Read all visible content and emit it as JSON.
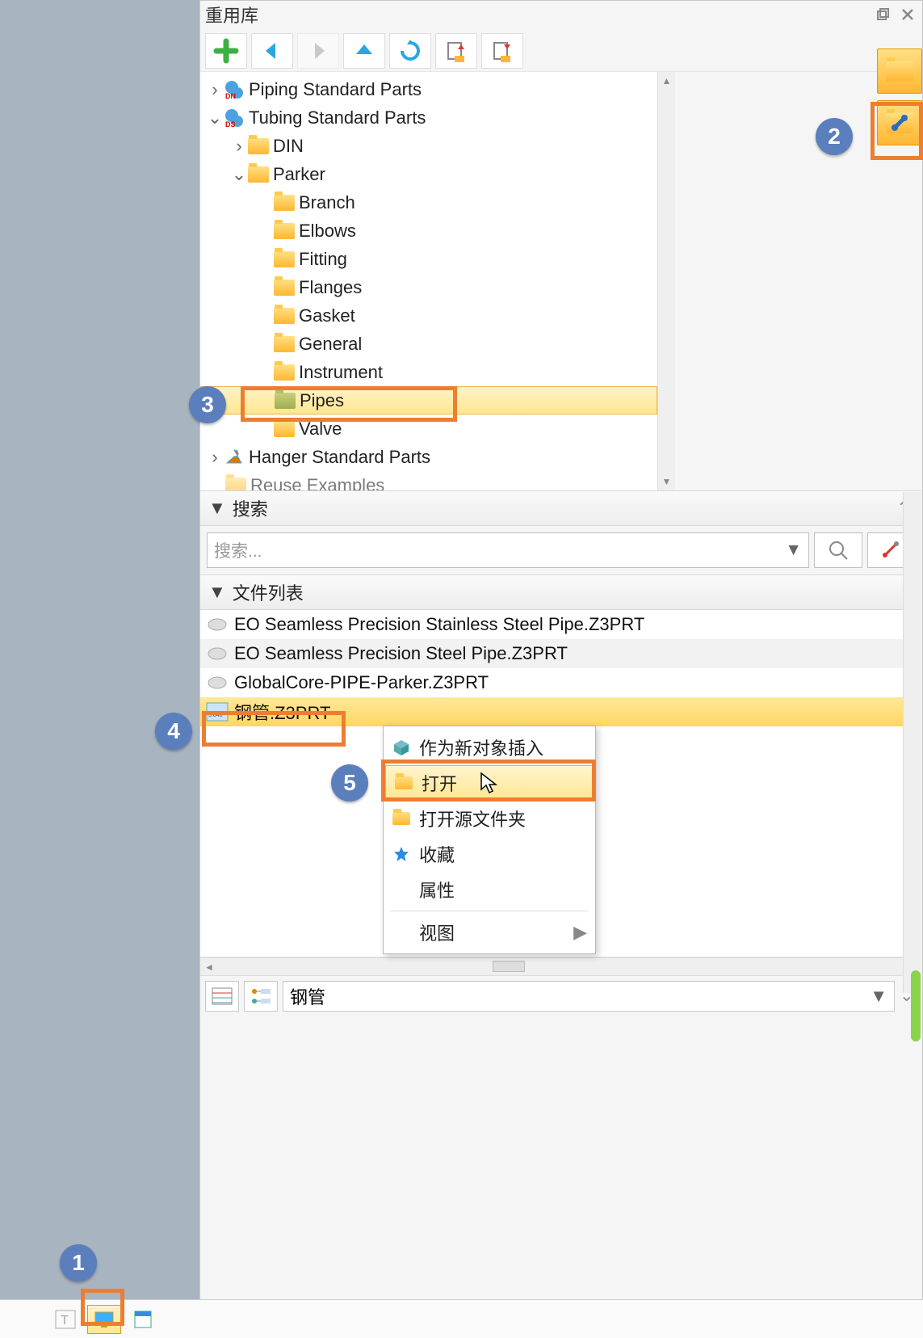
{
  "panel": {
    "title": "重用库"
  },
  "toolbar": {
    "icons": [
      "add",
      "back",
      "forward",
      "up",
      "refresh",
      "doc-up",
      "doc-down"
    ]
  },
  "tree": {
    "items": [
      {
        "label": "Piping Standard Parts",
        "icon": "pipe-dn",
        "arrow": ">"
      },
      {
        "label": "Tubing Standard Parts",
        "icon": "pipe-ds",
        "arrow": "v",
        "children": [
          {
            "label": "DIN",
            "icon": "folder",
            "arrow": ">"
          },
          {
            "label": "Parker",
            "icon": "folder-open",
            "arrow": "v",
            "children": [
              {
                "label": "Branch",
                "icon": "folder"
              },
              {
                "label": "Elbows",
                "icon": "folder"
              },
              {
                "label": "Fitting",
                "icon": "folder"
              },
              {
                "label": "Flanges",
                "icon": "folder"
              },
              {
                "label": "Gasket",
                "icon": "folder"
              },
              {
                "label": "General",
                "icon": "folder"
              },
              {
                "label": "Instrument",
                "icon": "folder"
              },
              {
                "label": "Pipes",
                "icon": "folder-sel",
                "selected": true
              },
              {
                "label": "Valve",
                "icon": "folder"
              }
            ]
          }
        ]
      },
      {
        "label": "Hanger Standard Parts",
        "icon": "hanger",
        "arrow": ">"
      },
      {
        "label": "Reuse Examples",
        "icon": "folder-star"
      }
    ]
  },
  "search": {
    "header": "搜索",
    "placeholder": "搜索..."
  },
  "filelist": {
    "header": "文件列表",
    "files": [
      "EO Seamless Precision Stainless Steel Pipe.Z3PRT",
      "EO Seamless Precision Steel Pipe.Z3PRT",
      "GlobalCore-PIPE-Parker.Z3PRT",
      "钢管.Z3PRT"
    ]
  },
  "context_menu": {
    "items": [
      {
        "label": "作为新对象插入",
        "icon": "cube"
      },
      {
        "label": "打开",
        "icon": "folder",
        "highlight": true
      },
      {
        "label": "打开源文件夹",
        "icon": "folder"
      },
      {
        "label": "收藏",
        "icon": "star"
      },
      {
        "label": "属性"
      },
      {
        "sep": true
      },
      {
        "label": "视图",
        "submenu": true
      }
    ]
  },
  "bottom": {
    "combo_value": "钢管"
  },
  "callouts": {
    "c1": "1",
    "c2": "2",
    "c3": "3",
    "c4": "4",
    "c5": "5"
  }
}
